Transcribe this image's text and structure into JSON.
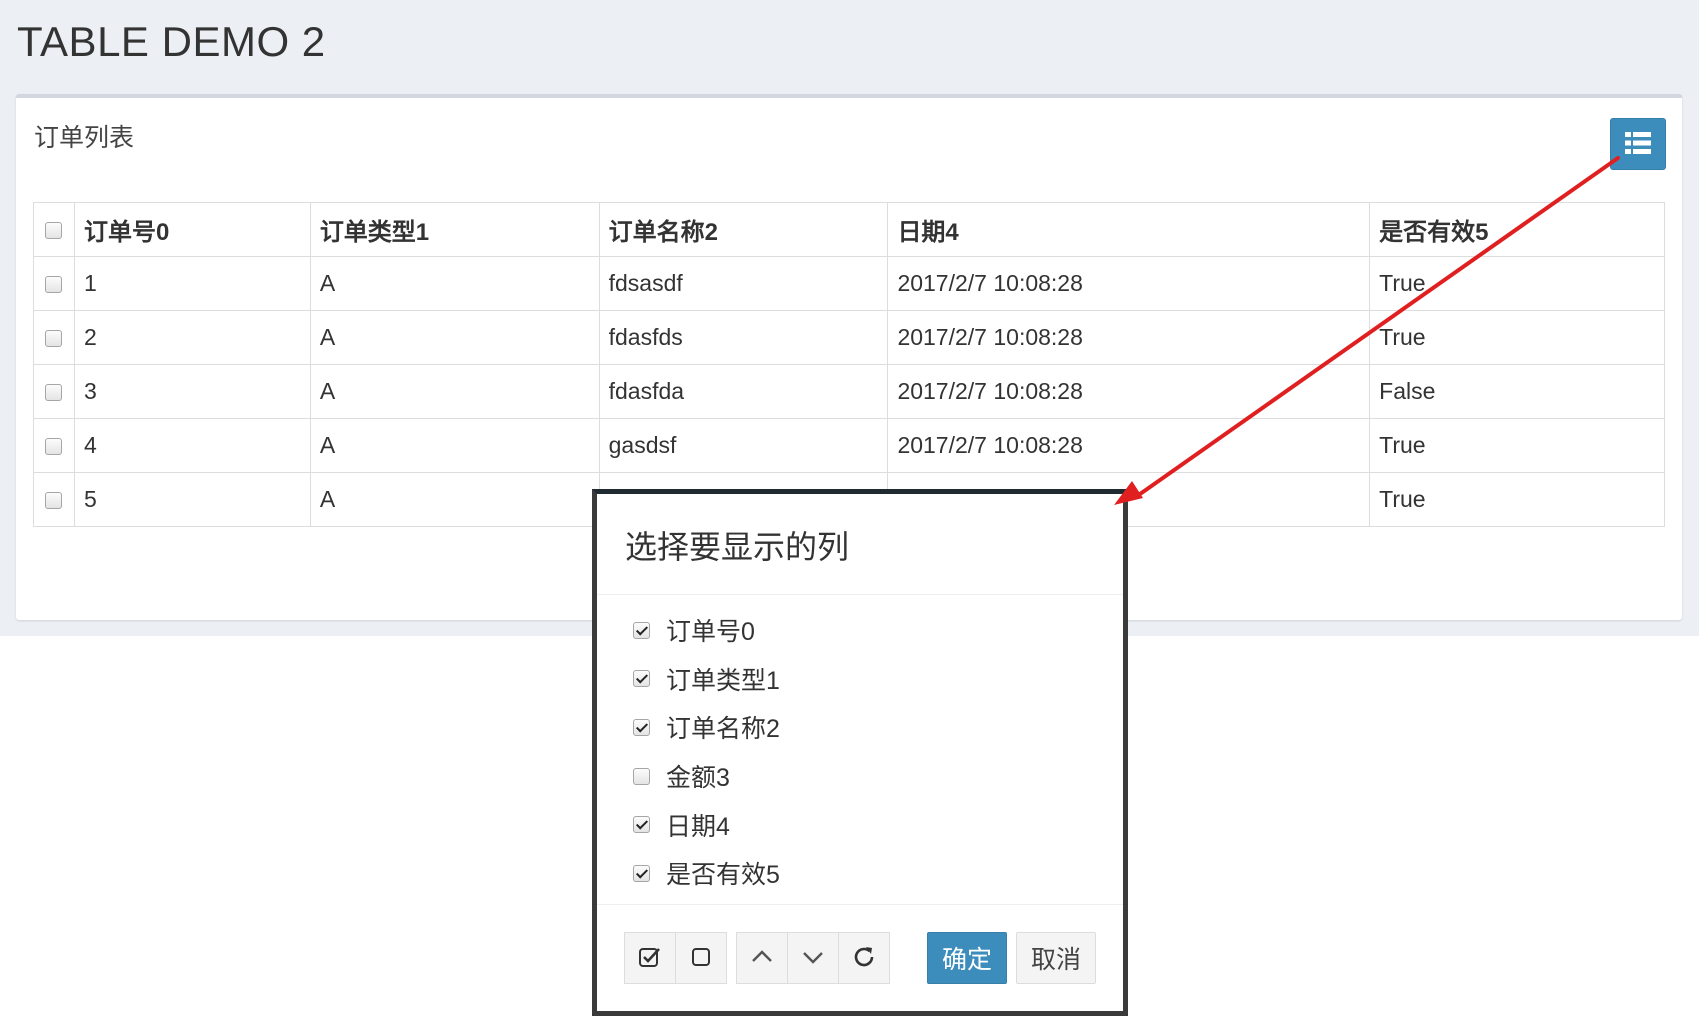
{
  "page": {
    "title": "TABLE DEMO 2"
  },
  "panel": {
    "title": "订单列表",
    "columns_button_icon": "list-icon"
  },
  "table": {
    "headers": [
      "订单号0",
      "订单类型1",
      "订单名称2",
      "日期4",
      "是否有效5"
    ],
    "rows": [
      [
        "1",
        "A",
        "fdsasdf",
        "2017/2/7 10:08:28",
        "True"
      ],
      [
        "2",
        "A",
        "fdasfds",
        "2017/2/7 10:08:28",
        "True"
      ],
      [
        "3",
        "A",
        "fdasfda",
        "2017/2/7 10:08:28",
        "False"
      ],
      [
        "4",
        "A",
        "gasdsf",
        "2017/2/7 10:08:28",
        "True"
      ],
      [
        "5",
        "A",
        "",
        "",
        "True"
      ]
    ]
  },
  "modal": {
    "title": "选择要显示的列",
    "columns": [
      {
        "label": "订单号0",
        "checked": true
      },
      {
        "label": "订单类型1",
        "checked": true
      },
      {
        "label": "订单名称2",
        "checked": true
      },
      {
        "label": "金额3",
        "checked": false
      },
      {
        "label": "日期4",
        "checked": true
      },
      {
        "label": "是否有效5",
        "checked": true
      }
    ],
    "tools": [
      "check-all-icon",
      "uncheck-all-icon",
      "chevron-up-icon",
      "chevron-down-icon",
      "refresh-icon"
    ],
    "ok_label": "确定",
    "cancel_label": "取消"
  },
  "colors": {
    "accent": "#3c8dbc",
    "annotation_arrow": "#e02020",
    "page_background": "#ecf0f5"
  }
}
